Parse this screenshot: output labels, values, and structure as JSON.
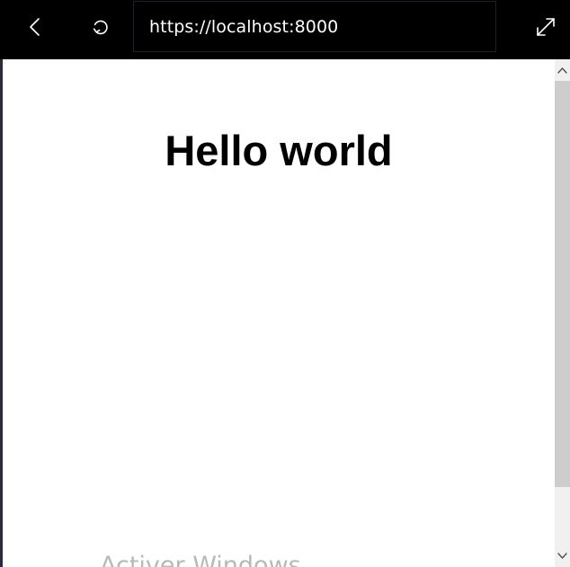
{
  "toolbar": {
    "back_icon": "chevron-left-icon",
    "refresh_icon": "refresh-icon",
    "address_url": "https://localhost:8000",
    "expand_icon": "expand-icon"
  },
  "page": {
    "heading": "Hello world",
    "watermark": "Activer Windows"
  },
  "scrollbar": {
    "up_icon": "chevron-up-icon",
    "down_icon": "chevron-down-icon"
  },
  "colors": {
    "toolbar_bg": "#000000",
    "page_bg": "#ffffff",
    "scrollbar_track": "#f0f0f0",
    "scrollbar_thumb": "#cdcdcd"
  }
}
